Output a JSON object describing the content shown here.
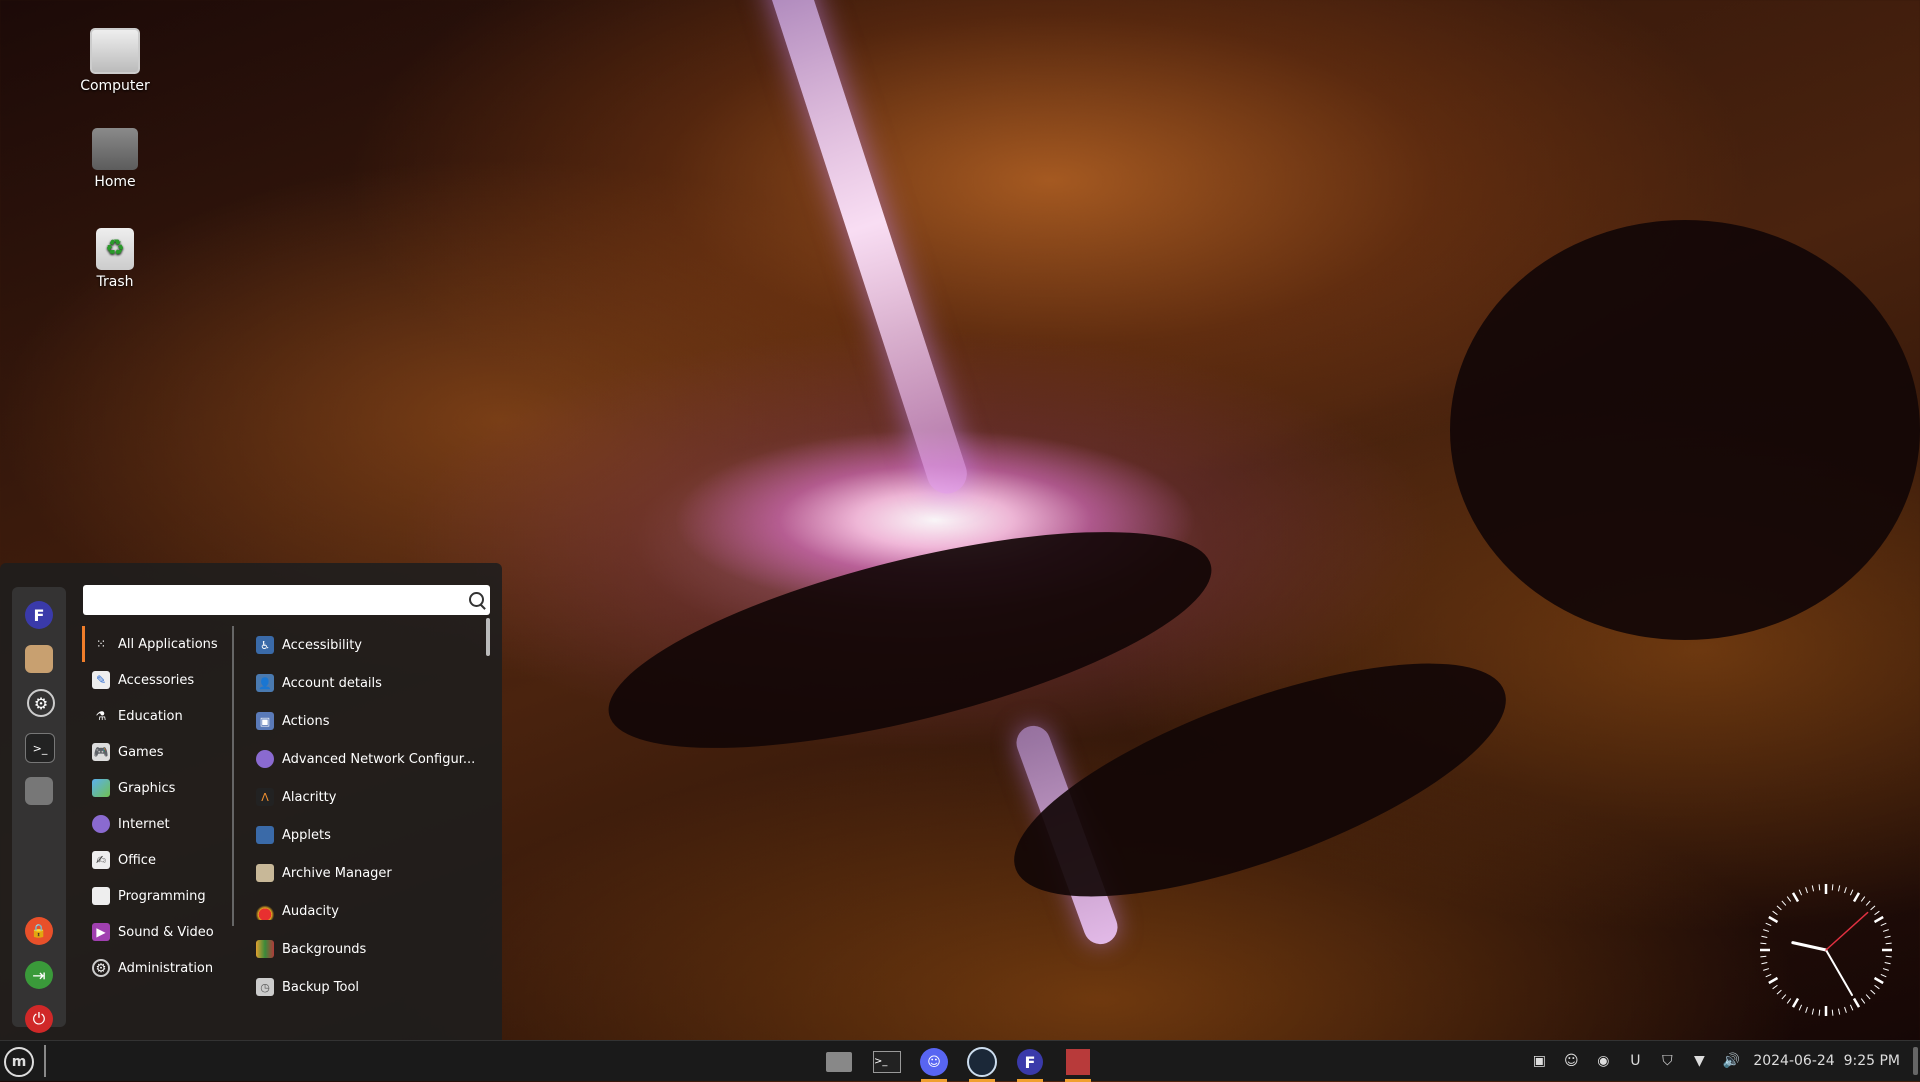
{
  "desktop": {
    "icons": [
      {
        "label": "Computer"
      },
      {
        "label": "Home"
      },
      {
        "label": "Trash"
      }
    ]
  },
  "menu": {
    "search": {
      "value": "",
      "placeholder": ""
    },
    "favorites": [
      "app-icon",
      "package-manager-icon",
      "settings-icon",
      "terminal-icon",
      "files-icon"
    ],
    "session": [
      "lock-icon",
      "logout-icon",
      "power-icon"
    ],
    "categories": [
      {
        "label": "All Applications",
        "icon": "grid-icon"
      },
      {
        "label": "Accessories",
        "icon": "accessories-icon"
      },
      {
        "label": "Education",
        "icon": "flask-icon"
      },
      {
        "label": "Games",
        "icon": "gamepad-icon"
      },
      {
        "label": "Graphics",
        "icon": "graphics-icon"
      },
      {
        "label": "Internet",
        "icon": "globe-icon"
      },
      {
        "label": "Office",
        "icon": "office-icon"
      },
      {
        "label": "Programming",
        "icon": "document-icon"
      },
      {
        "label": "Sound & Video",
        "icon": "play-icon"
      },
      {
        "label": "Administration",
        "icon": "gear-icon"
      }
    ],
    "apps": [
      {
        "label": "Accessibility",
        "icon": "accessibility-icon"
      },
      {
        "label": "Account details",
        "icon": "user-icon"
      },
      {
        "label": "Actions",
        "icon": "actions-icon"
      },
      {
        "label": "Advanced Network Configur...",
        "icon": "network-icon"
      },
      {
        "label": "Alacritty",
        "icon": "alacritty-icon"
      },
      {
        "label": "Applets",
        "icon": "applets-icon"
      },
      {
        "label": "Archive Manager",
        "icon": "archive-icon"
      },
      {
        "label": "Audacity",
        "icon": "audacity-icon"
      },
      {
        "label": "Backgrounds",
        "icon": "backgrounds-icon"
      },
      {
        "label": "Backup Tool",
        "icon": "backup-icon"
      }
    ]
  },
  "taskbar": {
    "start_label": "m",
    "pinned": [
      {
        "name": "files-icon"
      },
      {
        "name": "terminal-icon"
      },
      {
        "name": "discord-icon"
      },
      {
        "name": "steam-icon"
      },
      {
        "name": "app-icon"
      },
      {
        "name": "editor-icon"
      }
    ],
    "tray": [
      "screenshot-icon",
      "discord-tray-icon",
      "steam-tray-icon",
      "magnet-icon",
      "shield-icon",
      "wifi-icon",
      "volume-icon"
    ],
    "datetime": "2024-06-24  9:25 PM"
  },
  "clock": {
    "hour": 9,
    "minute": 25,
    "second": 8
  },
  "colors": {
    "accent": "#f07d2a",
    "menu_bg": "#1e1e1e",
    "lock": "#e8502a",
    "logout": "#3a9a3a",
    "power": "#d02828"
  }
}
